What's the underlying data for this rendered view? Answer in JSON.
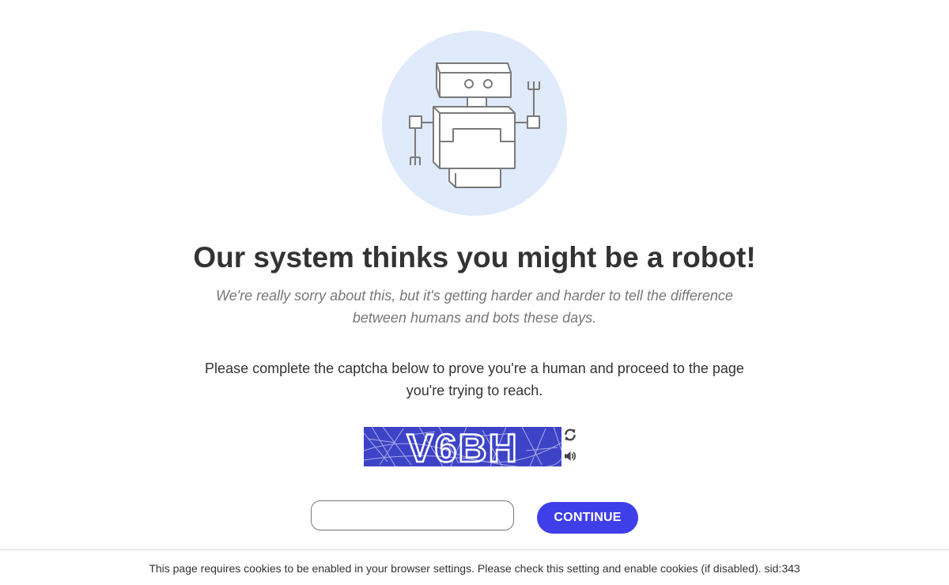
{
  "heading": "Our system thinks you might be a robot!",
  "subtitle": "We're really sorry about this, but it's getting harder and harder to tell the difference between humans and bots these days.",
  "instructions": "Please complete the captcha below to prove you're a human and proceed to the page you're trying to reach.",
  "captcha": {
    "text": "V6BH",
    "refresh_icon": "refresh-icon",
    "audio_icon": "speaker-icon"
  },
  "form": {
    "answer_value": "",
    "continue_label": "CONTINUE"
  },
  "footer": {
    "notice": "This page requires cookies to be enabled in your browser settings. Please check this setting and enable cookies (if disabled). sid:343"
  },
  "colors": {
    "accent": "#3e3fe8",
    "hero_background": "#dfeafb",
    "captcha_background": "#3d43c7"
  }
}
